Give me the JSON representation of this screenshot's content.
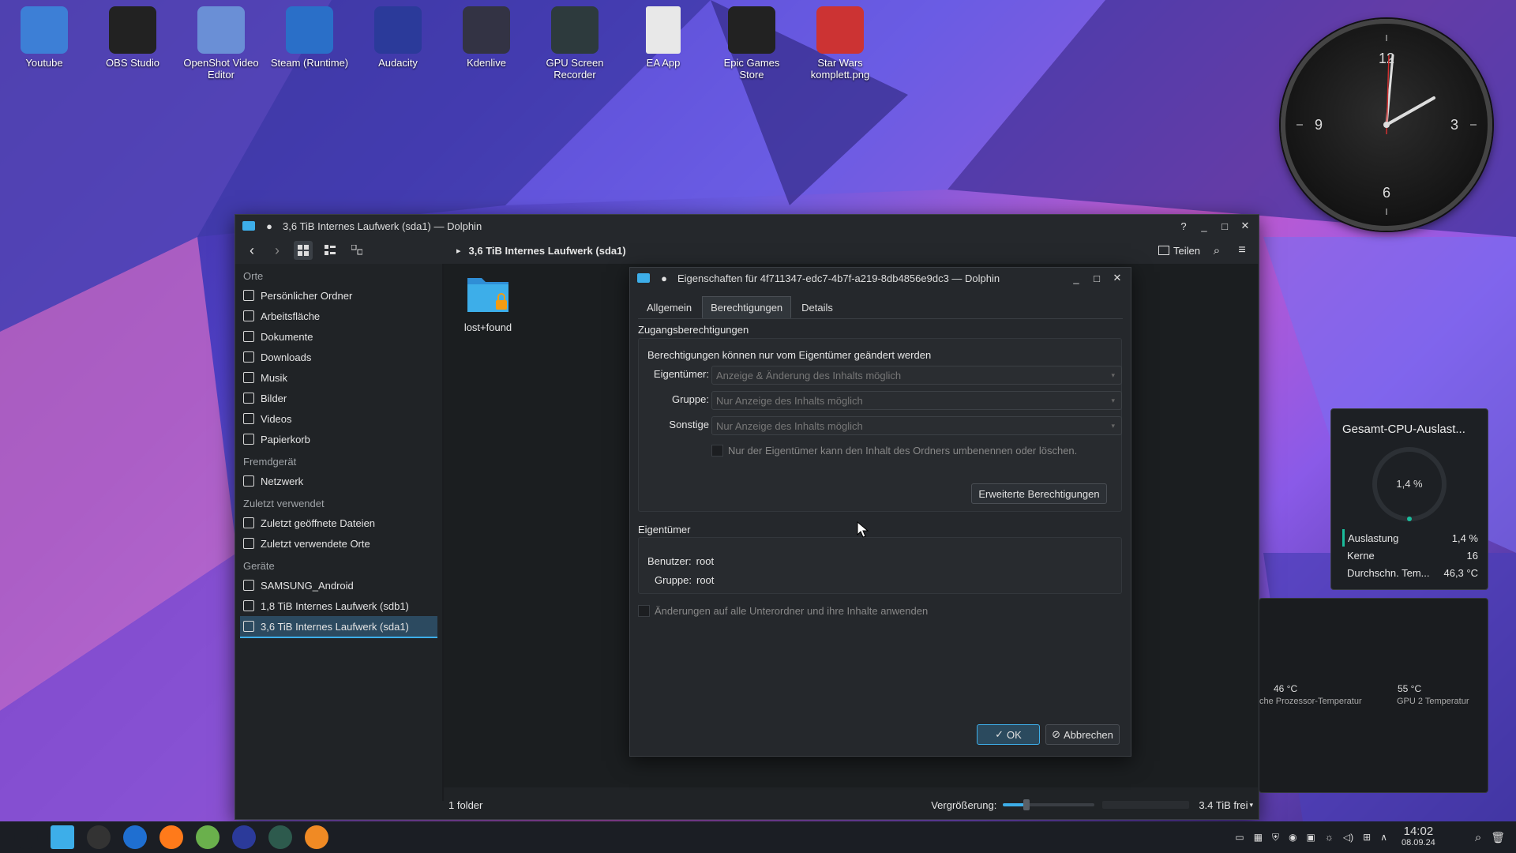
{
  "desktop_icons": [
    {
      "label": "Youtube",
      "icon": "youtube-folder-icon",
      "color": "#3d7fd6"
    },
    {
      "label": "OBS Studio",
      "icon": "obs-icon",
      "color": "#222"
    },
    {
      "label": "OpenShot Video Editor",
      "icon": "openshot-icon",
      "color": "#6a8fd6"
    },
    {
      "label": "Steam (Runtime)",
      "icon": "steam-icon",
      "color": "#2a6fc8"
    },
    {
      "label": "Audacity",
      "icon": "audacity-icon",
      "color": "#2b3a9a"
    },
    {
      "label": "Kdenlive",
      "icon": "kdenlive-icon",
      "color": "#334"
    },
    {
      "label": "GPU Screen Recorder",
      "icon": "gpu-recorder-icon",
      "color": "#2d3a3d"
    },
    {
      "label": "EA App",
      "icon": "document-icon",
      "color": "#e8e8e8"
    },
    {
      "label": "Epic Games Store",
      "icon": "epic-games-icon",
      "color": "#222"
    },
    {
      "label": "Star Wars komplett.png",
      "icon": "lego-starwars-icon",
      "color": "#c33"
    }
  ],
  "clock": {
    "numbers": [
      "12",
      "3",
      "6",
      "9"
    ]
  },
  "dolphin": {
    "title": "3,6 TiB Internes Laufwerk (sda1) — Dolphin",
    "breadcrumb": "3,6 TiB Internes Laufwerk (sda1)",
    "share_label": "Teilen",
    "sidebar": {
      "sections": [
        {
          "title": "Orte",
          "items": [
            "Persönlicher Ordner",
            "Arbeitsfläche",
            "Dokumente",
            "Downloads",
            "Musik",
            "Bilder",
            "Videos",
            "Papierkorb"
          ]
        },
        {
          "title": "Fremdgerät",
          "items": [
            "Netzwerk"
          ]
        },
        {
          "title": "Zuletzt verwendet",
          "items": [
            "Zuletzt geöffnete Dateien",
            "Zuletzt verwendete Orte"
          ]
        },
        {
          "title": "Geräte",
          "items": [
            "SAMSUNG_Android",
            "1,8 TiB Internes Laufwerk (sdb1)",
            "3,6 TiB Internes Laufwerk (sda1)"
          ]
        }
      ],
      "selected": "3,6 TiB Internes Laufwerk (sda1)"
    },
    "folder": {
      "name": "lost+found"
    },
    "status": {
      "count": "1 folder",
      "zoom_label": "Vergrößerung:",
      "free": "3.4 TiB frei"
    }
  },
  "dialog": {
    "title": "Eigenschaften für 4f711347-edc7-4b7f-a219-8db4856e9dc3 — Dolphin",
    "tabs": [
      "Allgemein",
      "Berechtigungen",
      "Details"
    ],
    "active_tab": "Berechtigungen",
    "access_title": "Zugangsberechtigungen",
    "note": "Berechtigungen können nur vom Eigentümer geändert werden",
    "owner_label": "Eigentümer:",
    "owner_value": "Anzeige & Änderung des Inhalts möglich",
    "group_label": "Gruppe:",
    "group_value": "Nur Anzeige des Inhalts möglich",
    "others_label": "Sonstige",
    "others_value": "Nur Anzeige des Inhalts möglich",
    "only_owner_checkbox": "Nur der Eigentümer kann den Inhalt des Ordners umbenennen oder löschen.",
    "advanced_button": "Erweiterte Berechtigungen",
    "ownership_title": "Eigentümer",
    "user_label": "Benutzer:",
    "user_value": "root",
    "group2_label": "Gruppe:",
    "group2_value": "root",
    "apply_recursive": "Änderungen auf alle Unterordner und ihre Inhalte anwenden",
    "ok": "OK",
    "cancel": "Abbrechen"
  },
  "cpu_widget": {
    "title": "Gesamt-CPU-Auslast...",
    "center": "1,4 %",
    "rows": [
      {
        "label": "Auslastung",
        "value": "1,4 %"
      },
      {
        "label": "Kerne",
        "value": "16"
      },
      {
        "label": "Durchschn. Tem...",
        "value": "46,3 °C"
      }
    ],
    "accent": "#1abc9c"
  },
  "temp_widget": {
    "items": [
      {
        "value": "46 °C",
        "label": "che Prozessor-Temperatur"
      },
      {
        "value": "55 °C",
        "label": "GPU 2 Temperatur"
      }
    ]
  },
  "taskbar": {
    "apps": [
      "launcher-icon",
      "dolphin-icon",
      "terminal-icon",
      "steam-icon",
      "firefox-icon",
      "downloader-icon",
      "audacity-icon",
      "gpu-recorder-icon",
      "blender-icon"
    ],
    "time": "14:02",
    "date": "08.09.24"
  }
}
